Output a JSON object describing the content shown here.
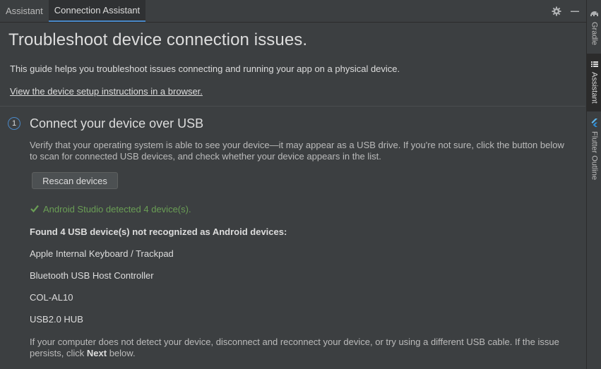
{
  "tabs": [
    {
      "label": "Assistant",
      "active": false
    },
    {
      "label": "Connection Assistant",
      "active": true
    }
  ],
  "toolbar": {
    "settings_icon": "gear-icon",
    "minimize_icon": "minimize-icon"
  },
  "right_strip": [
    {
      "label": "Gradle",
      "icon": "gradle-elephant-icon",
      "active": false
    },
    {
      "label": "Assistant",
      "icon": "list-icon",
      "active": true
    },
    {
      "label": "Flutter Outline",
      "icon": "flutter-icon",
      "active": false
    }
  ],
  "page": {
    "title": "Troubleshoot device connection issues.",
    "intro": "This guide helps you troubleshoot issues connecting and running your app on a physical device.",
    "link": "View the device setup instructions in a browser."
  },
  "step": {
    "number": "1",
    "title": "Connect your device over USB",
    "description": "Verify that your operating system is able to see your device—it may appear as a USB drive. If you're not sure, click the button below to scan for connected USB devices, and check whether your device appears in the list.",
    "button_label": "Rescan devices",
    "status": "Android Studio detected 4 device(s).",
    "found_title": "Found 4 USB device(s) not recognized as Android devices:",
    "devices": [
      "Apple Internal Keyboard / Trackpad",
      "Bluetooth USB Host Controller",
      "COL-AL10",
      "USB2.0 HUB"
    ],
    "footer_before": "If your computer does not detect your device, disconnect and reconnect your device, or try using a different USB cable. If the issue persists, click ",
    "footer_bold": "Next",
    "footer_after": " below."
  },
  "colors": {
    "accent": "#4a88c7",
    "success": "#6a9e55",
    "background": "#3c3f41"
  }
}
